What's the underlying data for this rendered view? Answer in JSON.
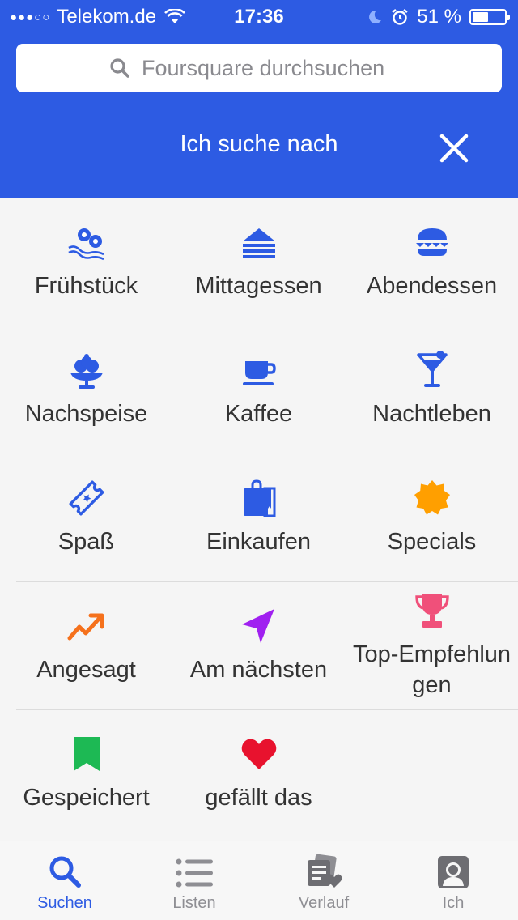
{
  "status": {
    "carrier": "Telekom.de",
    "time": "17:36",
    "battery": "51 %",
    "battery_level": 0.51
  },
  "search": {
    "placeholder": "Foursquare durchsuchen"
  },
  "filter": {
    "title": "Ich suche nach"
  },
  "categories": [
    {
      "label": "Frühstück",
      "icon": "breakfast-icon",
      "color": "#2d5be3"
    },
    {
      "label": "Mittagessen",
      "icon": "sandwich-icon",
      "color": "#2d5be3"
    },
    {
      "label": "Abendessen",
      "icon": "burger-icon",
      "color": "#2d5be3"
    },
    {
      "label": "Nachspeise",
      "icon": "ice-cream-icon",
      "color": "#2d5be3"
    },
    {
      "label": "Kaffee",
      "icon": "coffee-cup-icon",
      "color": "#2d5be3"
    },
    {
      "label": "Nachtleben",
      "icon": "cocktail-icon",
      "color": "#2d5be3"
    },
    {
      "label": "Spaß",
      "icon": "ticket-icon",
      "color": "#2d5be3"
    },
    {
      "label": "Einkaufen",
      "icon": "shopping-bag-icon",
      "color": "#2d5be3"
    },
    {
      "label": "Specials",
      "icon": "badge-icon",
      "color": "#ff9f00"
    },
    {
      "label": "Angesagt",
      "icon": "trending-icon",
      "color": "#f5711c"
    },
    {
      "label": "Am nächsten",
      "icon": "navigation-arrow-icon",
      "color": "#a020f0"
    },
    {
      "label": "Top-Empfehlungen",
      "icon": "trophy-icon",
      "color": "#f0507a"
    },
    {
      "label": "Gespeichert",
      "icon": "bookmark-icon",
      "color": "#1db954"
    },
    {
      "label": "gefällt das",
      "icon": "heart-icon",
      "color": "#e8122e"
    }
  ],
  "tabs": [
    {
      "label": "Suchen",
      "icon": "search-icon",
      "active": true
    },
    {
      "label": "Listen",
      "icon": "list-icon",
      "active": false
    },
    {
      "label": "Verlauf",
      "icon": "history-icon",
      "active": false
    },
    {
      "label": "Ich",
      "icon": "profile-icon",
      "active": false
    }
  ],
  "colors": {
    "brand": "#2d5be3",
    "tab_inactive": "#8e8e93"
  }
}
